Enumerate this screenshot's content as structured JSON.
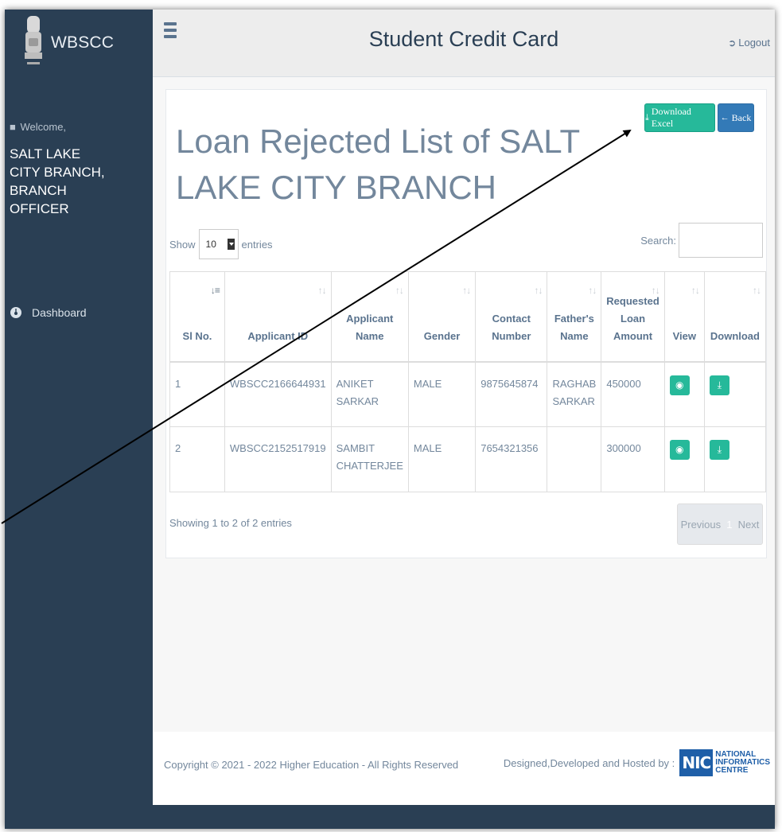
{
  "brand": {
    "name": "WBSCC"
  },
  "sidebar": {
    "welcome": "Welcome,",
    "username": "SALT LAKE CITY BRANCH, BRANCH OFFICER",
    "items": [
      {
        "label": "Dashboard",
        "icon": "dashboard-icon"
      }
    ]
  },
  "header": {
    "title": "Student Credit Card",
    "logout": "Logout"
  },
  "page": {
    "title": "Loan Rejected List of SALT LAKE CITY BRANCH",
    "download_excel": "Download Excel",
    "back": "Back"
  },
  "table": {
    "length_label_before": "Show",
    "length_value": "10",
    "length_label_after": "entries",
    "search_label": "Search:",
    "search_value": "",
    "columns": [
      "Sl No.",
      "Applicant ID",
      "Applicant Name",
      "Gender",
      "Contact Number",
      "Father's Name",
      "Requested Loan Amount",
      "View",
      "Download"
    ],
    "rows": [
      {
        "sl": "1",
        "applicant_id": "WBSCC2166644931",
        "name": "ANIKET SARKAR",
        "gender": "MALE",
        "contact": "9875645874",
        "father": "RAGHAB SARKAR",
        "amount": "450000"
      },
      {
        "sl": "2",
        "applicant_id": "WBSCC2152517919",
        "name": "SAMBIT CHATTERJEE",
        "gender": "MALE",
        "contact": "7654321356",
        "father": "",
        "amount": "300000"
      }
    ],
    "info": "Showing 1 to 2 of 2 entries",
    "pagination": {
      "previous": "Previous",
      "current": "1",
      "next": "Next"
    }
  },
  "footer": {
    "copyright": "Copyright © 2021 - 2022 Higher Education - All Rights Reserved",
    "hosted_by": "Designed,Developed and Hosted by :",
    "nic_mark": "NIC",
    "nic_line1": "NATIONAL",
    "nic_line2": "INFORMATICS",
    "nic_line3": "CENTRE"
  },
  "colors": {
    "sidebar": "#2a3f54",
    "accent_green": "#26b99a",
    "accent_blue": "#337ab7",
    "text_muted": "#73879c"
  }
}
